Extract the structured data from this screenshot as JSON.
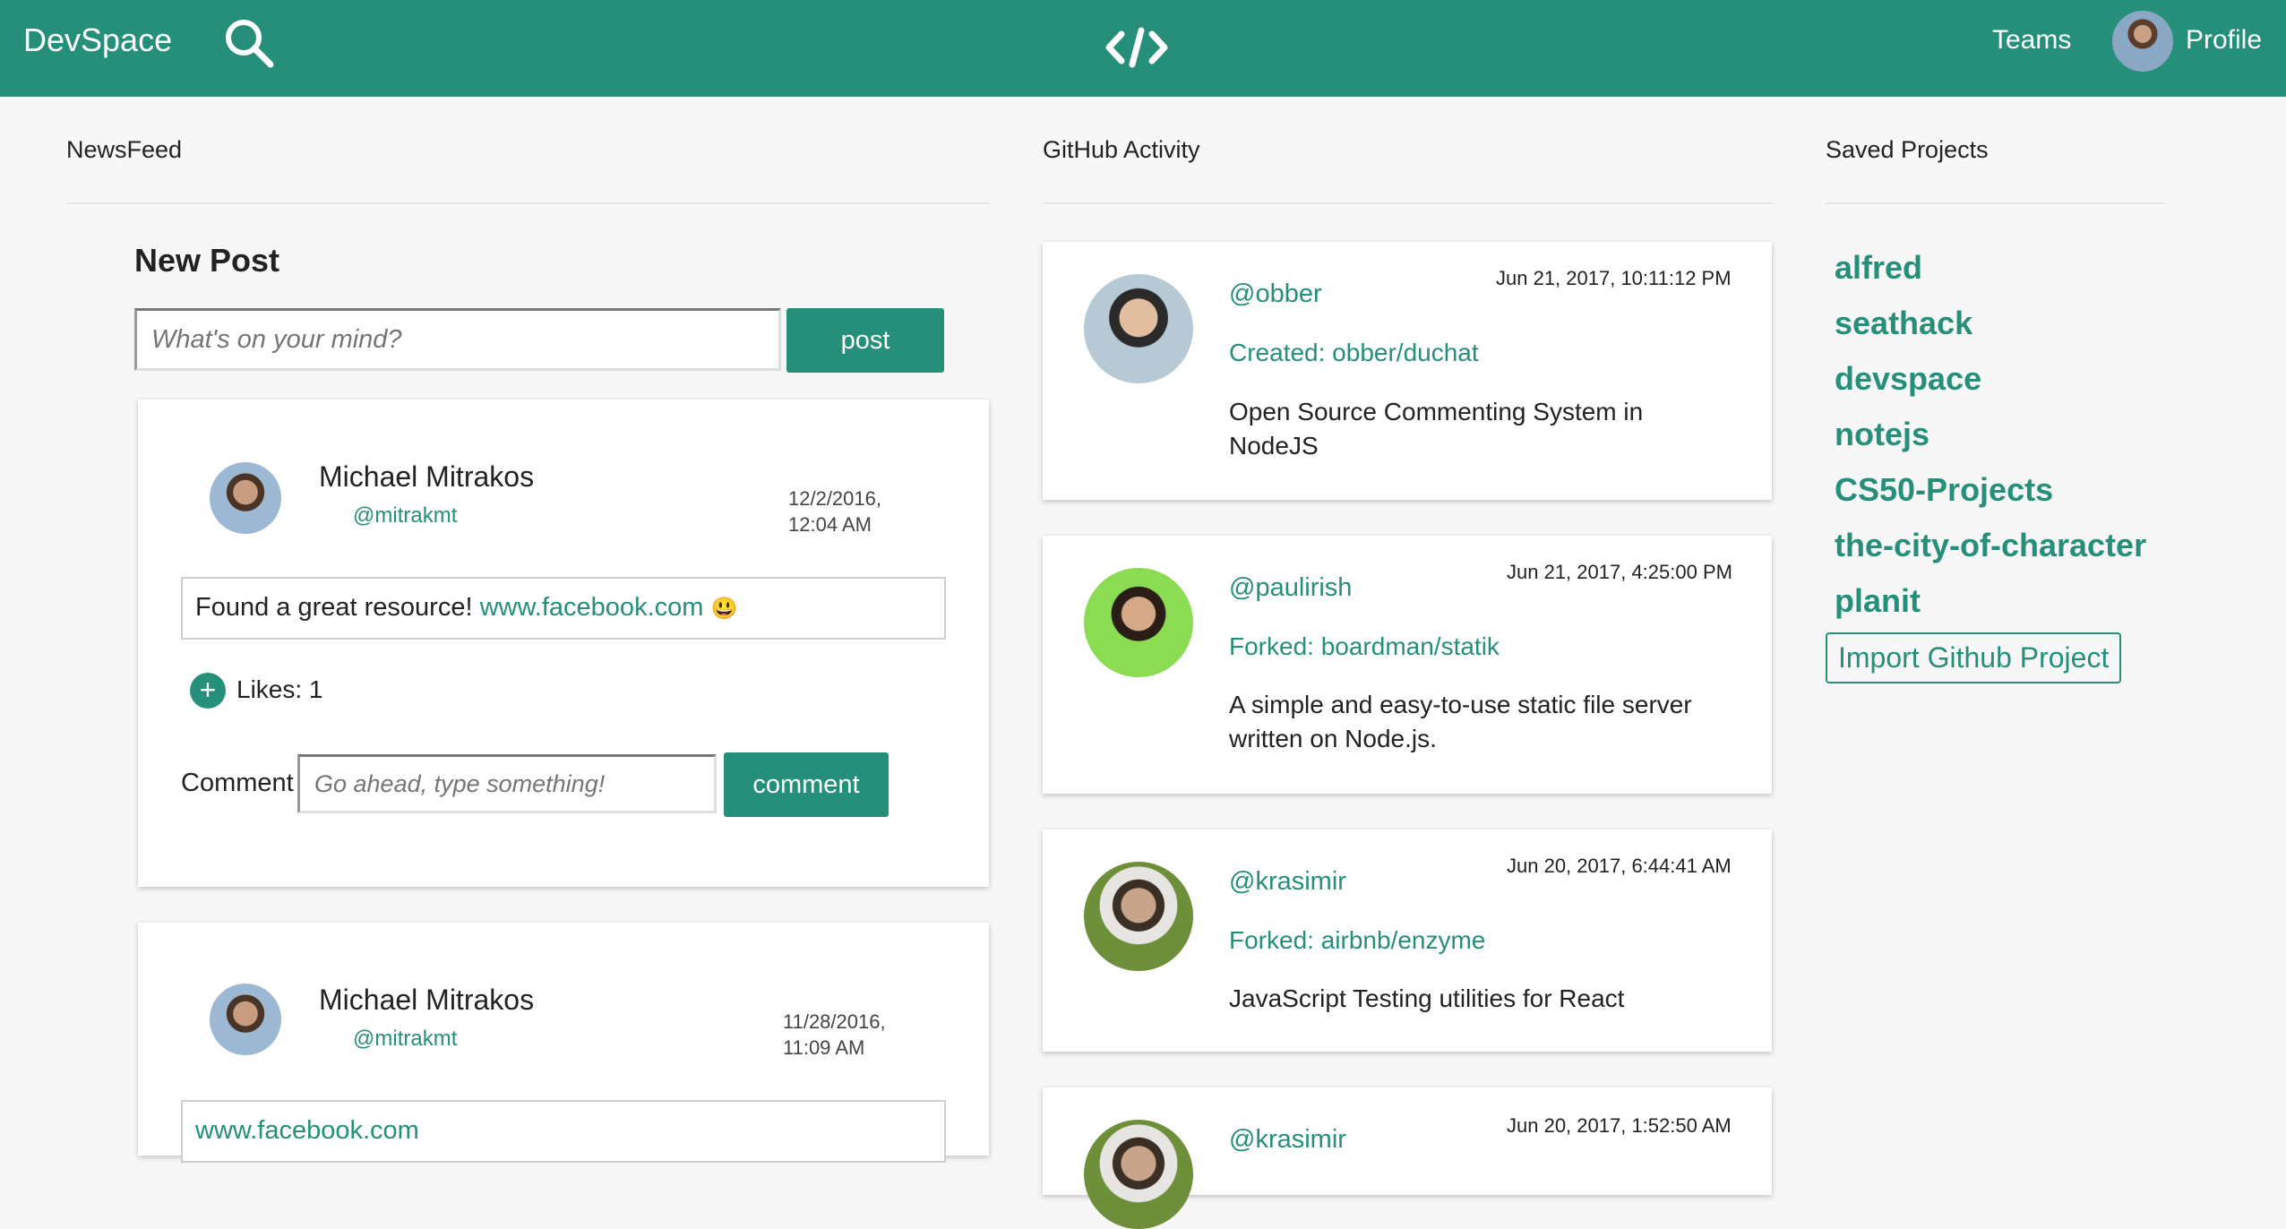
{
  "nav": {
    "brand": "DevSpace",
    "search_icon": "search-icon",
    "center_icon": "code-icon",
    "teams": "Teams",
    "profile": "Profile",
    "color": "#268f79"
  },
  "newsfeed": {
    "title": "NewsFeed",
    "new_post": {
      "heading": "New Post",
      "placeholder": "What's on your mind?",
      "button": "post"
    },
    "posts": [
      {
        "author": "Michael Mitrakos",
        "handle": "@mitrakmt",
        "date_line1": "12/2/2016,",
        "date_line2": "12:04 AM",
        "text": "Found a great resource!",
        "link": "www.facebook.com",
        "emoji": "😃",
        "likes": "Likes: 1",
        "comment_label": "Comment",
        "comment_placeholder": "Go ahead, type something!",
        "comment_button": "comment"
      },
      {
        "author": "Michael Mitrakos",
        "handle": "@mitrakmt",
        "date_line1": "11/28/2016,",
        "date_line2": "11:09 AM",
        "link": "www.facebook.com"
      }
    ]
  },
  "github": {
    "title": "GitHub Activity",
    "items": [
      {
        "handle": "@obber",
        "date": "Jun 21, 2017, 10:11:12 PM",
        "action": "Created: obber/duchat",
        "desc_line1": "Open Source Commenting System in",
        "desc_line2": "NodeJS"
      },
      {
        "handle": "@paulirish",
        "date": "Jun 21, 2017, 4:25:00 PM",
        "action": "Forked: boardman/statik",
        "desc_line1": "A simple and easy-to-use static file server",
        "desc_line2": "written on Node.js."
      },
      {
        "handle": "@krasimir",
        "date": "Jun 20, 2017, 6:44:41 AM",
        "action": "Forked: airbnb/enzyme",
        "desc_line1": "JavaScript Testing utilities for React"
      },
      {
        "handle": "@krasimir",
        "date": "Jun 20, 2017, 1:52:50 AM"
      }
    ]
  },
  "saved": {
    "title": "Saved Projects",
    "items": [
      "alfred",
      "seathack",
      "devspace",
      "notejs",
      "CS50-Projects",
      "the-city-of-character",
      "planit"
    ],
    "import_button": "Import Github Project"
  }
}
